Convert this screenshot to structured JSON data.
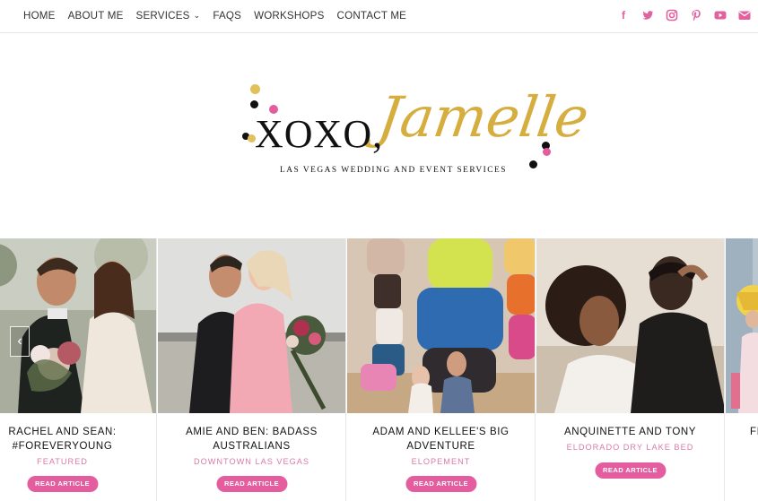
{
  "nav": {
    "items": [
      "HOME",
      "ABOUT ME",
      "SERVICES",
      "FAQS",
      "WORKSHOPS",
      "CONTACT ME"
    ]
  },
  "social": [
    "facebook-icon",
    "twitter-icon",
    "instagram-icon",
    "pinterest-icon",
    "youtube-icon",
    "email-icon"
  ],
  "logo": {
    "main": "XOXO,",
    "script": "Jamelle",
    "subtitle": "LAS VEGAS WEDDING AND EVENT SERVICES"
  },
  "colors": {
    "accent": "#e35d9f",
    "gold": "#d6ad3f",
    "category": "#d97aa8"
  },
  "carousel": {
    "prev_icon": "chevron-left-icon",
    "cards": [
      {
        "title": "RACHEL AND SEAN: #FOREVERYOUNG",
        "category": "FEATURED",
        "button": "READ ARTICLE"
      },
      {
        "title": "AMIE AND BEN: BADASS AUSTRALIANS",
        "category": "DOWNTOWN LAS VEGAS",
        "button": "READ ARTICLE"
      },
      {
        "title": "ADAM AND KELLEE'S BIG ADVENTURE",
        "category": "ELOPEMENT",
        "button": "READ ARTICLE"
      },
      {
        "title": "ANQUINETTE AND TONY",
        "category": "ELDORADO DRY LAKE BED",
        "button": "READ ARTICLE"
      },
      {
        "title": "FI",
        "category": "",
        "button": ""
      }
    ]
  }
}
